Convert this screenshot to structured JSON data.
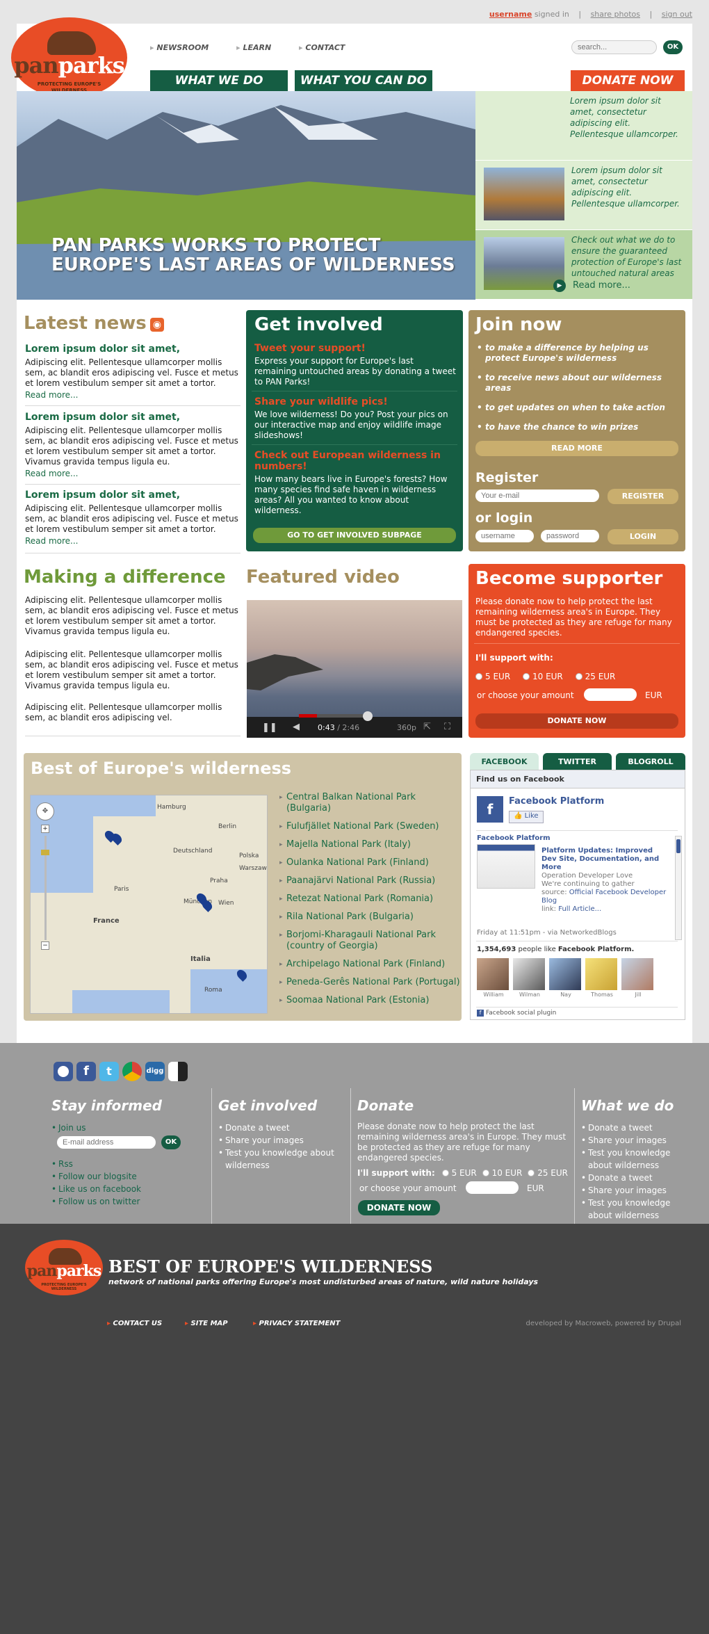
{
  "topbar": {
    "username": "username",
    "signed_in": "signed in",
    "share": "share photos",
    "signout": "sign out"
  },
  "logo": {
    "pan": "pan",
    "parks": "parks",
    "tagline": "PROTECTING EUROPE'S WILDERNESS"
  },
  "nav": {
    "items": [
      "NEWSROOM",
      "LEARN",
      "CONTACT"
    ]
  },
  "search": {
    "placeholder": "search...",
    "ok": "OK"
  },
  "buttons": {
    "what_we_do": "WHAT WE DO",
    "what_you_can_do": "WHAT YOU CAN DO",
    "donate": "DONATE NOW"
  },
  "hero": {
    "line1": "PAN PARKS WORKS TO PROTECT",
    "line2": "EUROPE'S LAST AREAS OF WILDERNESS"
  },
  "side": {
    "p1": "Lorem ipsum dolor sit amet, consectetur adipiscing elit. Pellentesque ullamcorper.",
    "p2": "Lorem ipsum dolor sit amet, consectetur adipiscing elit. Pellentesque ullamcorper.",
    "p3": "Check out what we do to ensure the guaranteed protection of Europe's last untouched natural areas",
    "readmore": "Read more..."
  },
  "news": {
    "title": "Latest news",
    "items": [
      {
        "title": "Lorem ipsum dolor sit amet,",
        "body": "Adipiscing elit. Pellentesque ullamcorper mollis sem, ac blandit eros adipiscing vel. Fusce et metus et lorem vestibulum semper sit amet a tortor.",
        "more": "Read more..."
      },
      {
        "title": "Lorem ipsum dolor sit amet,",
        "body": "Adipiscing elit. Pellentesque ullamcorper mollis sem, ac blandit eros adipiscing vel. Fusce et metus et lorem vestibulum semper sit amet a tortor. Vivamus gravida tempus ligula eu.",
        "more": "Read more..."
      },
      {
        "title": "Lorem ipsum dolor sit amet,",
        "body": "Adipiscing elit. Pellentesque ullamcorper mollis sem, ac blandit eros adipiscing vel. Fusce et metus et lorem vestibulum semper sit amet a tortor.",
        "more": "Read more..."
      }
    ]
  },
  "involved": {
    "title": "Get involved",
    "h1": "Tweet your support!",
    "t1": "Express your support for Europe's last remaining untouched areas by donating a tweet to PAN Parks!",
    "h2": "Share your wildlife pics!",
    "t2": "We love wilderness! Do you? Post your pics on our interactive map and enjoy wildlife image slideshows!",
    "h3": "Check out European wilderness in numbers!",
    "t3": "How many bears live in Europe's forests? How many species find safe haven in wilderness areas? All you wanted to know about wilderness.",
    "button": "GO TO GET INVOLVED SUBPAGE"
  },
  "join": {
    "title": "Join now",
    "items": [
      "to make a difference by helping us protect Europe's wilderness",
      "to receive news about our wilderness areas",
      "to get updates on when to take action",
      "to have the chance to win prizes"
    ],
    "readmore": "READ MORE",
    "register": "Register",
    "email_placeholder": "Your e-mail",
    "register_btn": "REGISTER",
    "login": "or login",
    "username": "username",
    "password": "password",
    "login_btn": "LOGIN"
  },
  "making": {
    "title": "Making a difference",
    "p1": "Adipiscing elit. Pellentesque ullamcorper mollis sem, ac blandit eros adipiscing vel. Fusce et metus et lorem vestibulum semper sit amet a tortor. Vivamus gravida tempus ligula eu.",
    "p2": "Adipiscing elit. Pellentesque ullamcorper mollis sem, ac blandit eros adipiscing vel. Fusce et metus et lorem vestibulum semper sit amet a tortor. Vivamus gravida tempus ligula eu.",
    "p3": "Adipiscing elit. Pellentesque ullamcorper mollis sem, ac blandit eros adipiscing vel."
  },
  "video": {
    "title": "Featured video",
    "time": "0:43",
    "duration": "/ 2:46",
    "quality": "360p",
    "progress": 0.26
  },
  "supporter": {
    "title": "Become supporter",
    "text": "Please donate now to help protect the last remaining wilderness area's in Europe. They must be protected as they are refuge for many endangered species.",
    "support": "I'll support with:",
    "opt1": "5 EUR",
    "opt2": "10 EUR",
    "opt3": "25 EUR",
    "choose": "or choose your amount",
    "eur": "EUR",
    "button": "DONATE NOW"
  },
  "best": {
    "title": "Best of Europe's wilderness",
    "parks": [
      "Central Balkan National Park (Bulgaria)",
      "Fulufjället National Park (Sweden)",
      "Majella National Park (Italy)",
      "Oulanka National Park (Finland)",
      "Paanajärvi National Park (Russia)",
      "Retezat National Park (Romania)",
      "Rila National Park (Bulgaria)",
      "Borjomi-Kharagauli National Park (country of Georgia)",
      "Archipelago National Park (Finland)",
      "Peneda-Gerês National Park (Portugal)",
      "Soomaa National Park (Estonia)"
    ],
    "map_labels": [
      "Hamburg",
      "Berlin",
      "Deutschland",
      "Polska",
      "Warszawa",
      "Paris",
      "France",
      "Wien",
      "Italia",
      "Roma",
      "Praha",
      "München"
    ]
  },
  "social_tabs": {
    "facebook": "FACEBOOK",
    "twitter": "TWITTER",
    "blogroll": "BLOGROLL"
  },
  "fb": {
    "find": "Find us on Facebook",
    "page": "Facebook Platform",
    "like": "Like",
    "post_author": "Facebook Platform",
    "post_title": "Platform Updates: Improved Dev Site, Documentation, and More",
    "post_sub1": "Operation Developer Love",
    "post_sub2": "We're continuing to gather",
    "source_label": "source:",
    "source": "Official Facebook Developer Blog",
    "link_label": "link:",
    "link": "Full Article...",
    "time": "Friday at 11:51pm - via NetworkedBlogs",
    "count": "1,354,693",
    "count_text": "people like",
    "count_page": "Facebook Platform.",
    "people": [
      "William",
      "Wilman",
      "Nay",
      "Thomas",
      "Jill"
    ],
    "plugin": "Facebook social plugin"
  },
  "footer": {
    "stay": "Stay informed",
    "stay_items": [
      "Join us",
      "Rss",
      "Follow our blogsite",
      "Like us on facebook",
      "Follow us on twitter"
    ],
    "email_placeholder": "E-mail address",
    "ok": "OK",
    "involved": "Get involved",
    "involved_items": [
      "Donate a tweet",
      "Share your images",
      "Test you knowledge about wilderness"
    ],
    "donate": "Donate",
    "donate_text": "Please donate now to help protect the last remaining wilderness area's in Europe. They must be protected as they are refuge for many endangered species.",
    "support": "I'll support with:",
    "opt1": "5 EUR",
    "opt2": "10 EUR",
    "opt3": "25 EUR",
    "choose": "or choose your amount",
    "eur": "EUR",
    "donate_btn": "DONATE NOW",
    "what": "What we do",
    "what_items": [
      "Donate a tweet",
      "Share your images",
      "Test you knowledge about wilderness",
      "Donate a tweet",
      "Share your images",
      "Test you knowledge about wilderness"
    ]
  },
  "bottom": {
    "title": "BEST OF EUROPE'S WILDERNESS",
    "subtitle": "network of national parks offering Europe's most undisturbed areas of nature, wild nature holidays",
    "links": [
      "CONTACT US",
      "SITE MAP",
      "PRIVACY STATEMENT"
    ],
    "credit": "developed by Macroweb, powered by Drupal"
  },
  "colors": {
    "green": "#155d43",
    "orange": "#e84d26",
    "tan": "#a58f5f",
    "lightgreen": "#6f9a3a"
  }
}
